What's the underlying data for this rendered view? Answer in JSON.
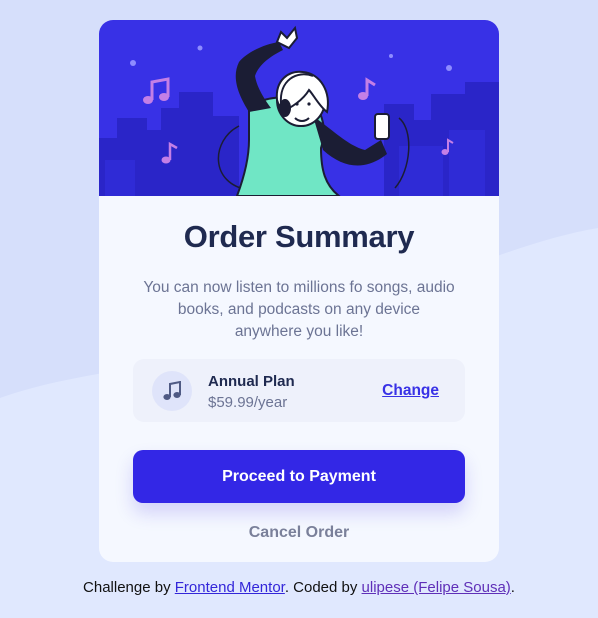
{
  "card": {
    "title": "Order Summary",
    "description": "You can now listen to millions fo songs, audio books, and podcasts on any device anywhere you like!",
    "plan": {
      "icon": "music-note-icon",
      "name": "Annual Plan",
      "price": "$59.99/year",
      "change_label": "Change"
    },
    "proceed_label": "Proceed to Payment",
    "cancel_label": "Cancel Order"
  },
  "footer": {
    "prefix": "Challenge by ",
    "challenge_link": "Frontend Mentor",
    "middle": ". Coded by ",
    "author_link": "ulipese (Felipe Sousa)",
    "suffix": "."
  },
  "colors": {
    "page_background": "#e0e8fe",
    "hero_background": "#3831e6",
    "primary_button": "#3327e6",
    "title_text": "#1f2a50",
    "muted_text": "#6c7494"
  }
}
